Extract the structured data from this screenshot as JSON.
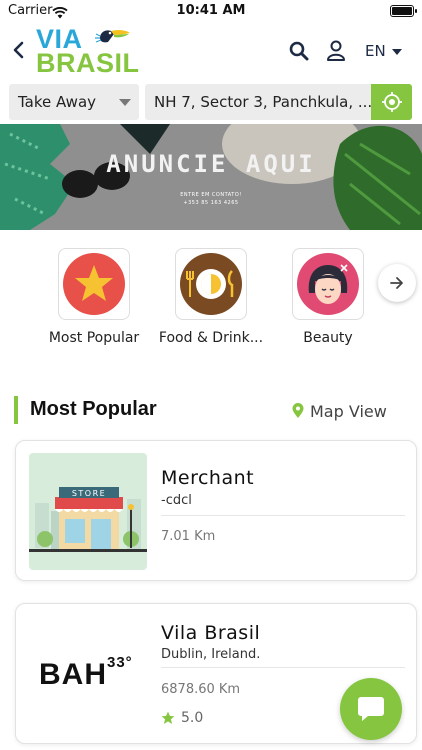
{
  "status": {
    "carrier": "Carrier",
    "time": "10:41 AM"
  },
  "header": {
    "logo_line1": "VIA",
    "logo_line2": "BRASIL",
    "language": "EN"
  },
  "filter": {
    "mode": "Take Away",
    "address": "NH 7, Sector 3, Panchkula, ..."
  },
  "banner": {
    "title": "ANUNCIE AQUI",
    "subtitle": "ENTRE EM CONTATO!",
    "phone": "+353 85 163 4265"
  },
  "categories": [
    {
      "label": "Most Popular",
      "icon": "star-icon"
    },
    {
      "label": "Food & Drink...",
      "icon": "plate-cutlery-icon"
    },
    {
      "label": "Beauty",
      "icon": "woman-face-icon"
    }
  ],
  "section": {
    "title": "Most Popular",
    "map_view": "Map View"
  },
  "listings": [
    {
      "name": "Merchant",
      "subtitle": "-cdcl",
      "distance": "7.01 Km",
      "thumb_text": "STORE"
    },
    {
      "name": "Vila Brasil",
      "subtitle": "Dublin, Ireland.",
      "distance": "6878.60 Km",
      "rating": "5.0",
      "thumb_text": "BAH",
      "thumb_sup": "33°"
    }
  ],
  "colors": {
    "accent": "#86c540",
    "logo_blue": "#2aa7d9"
  }
}
